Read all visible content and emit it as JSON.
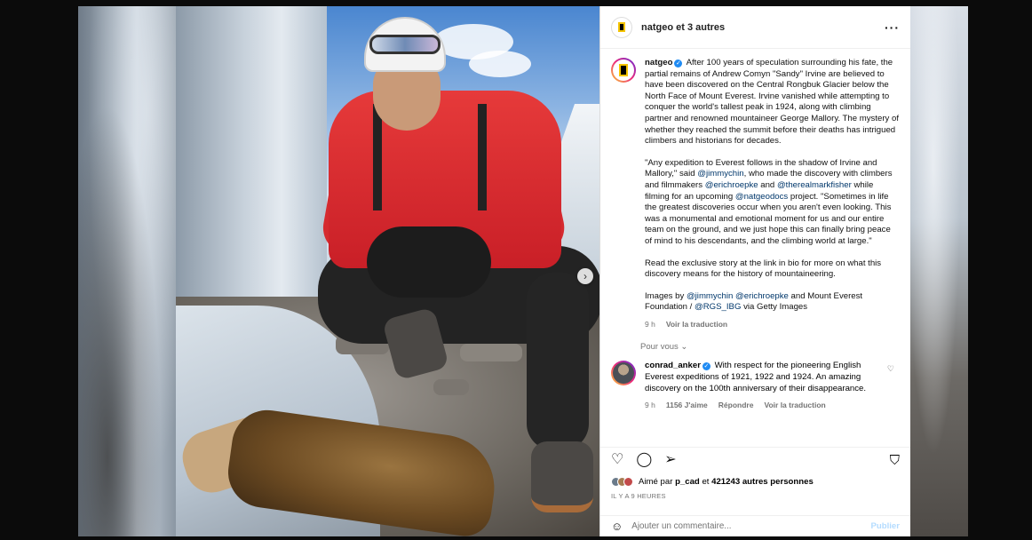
{
  "header": {
    "username": "natgeo et 3 autres",
    "more_icon": "more-horizontal-icon"
  },
  "caption": {
    "username": "natgeo",
    "paragraph1": "After 100 years of speculation surrounding his fate, the partial remains of Andrew Comyn \"Sandy\" Irvine are believed to have been discovered on the Central Rongbuk Glacier below the North Face of Mount Everest. Irvine vanished while attempting to conquer the world's tallest peak in 1924, along with climbing partner and renowned mountaineer George Mallory. The mystery of whether they reached the summit before their deaths has intrigued climbers and historians for decades.",
    "p2_a": "\"Any expedition to Everest follows in the shadow of Irvine and Mallory,\" said ",
    "p2_m1": "@jimmychin",
    "p2_b": ", who made the discovery with climbers and filmmakers ",
    "p2_m2": "@erichroepke",
    "p2_c": " and ",
    "p2_m3": "@therealmarkfisher",
    "p2_d": " while filming for an upcoming ",
    "p2_m4": "@natgeodocs",
    "p2_e": " project. \"Sometimes in life the greatest discoveries occur when you aren't even looking. This was a monumental and emotional moment for us and our entire team on the ground, and we just hope this can finally bring peace of mind to his descendants, and the climbing world at large.\"",
    "paragraph3": "Read the exclusive story at the link in bio for more on what this discovery means for the history of mountaineering.",
    "p4_a": "Images by ",
    "p4_m1": "@jimmychin",
    "p4_m2": "@erichroepke",
    "p4_b": " and Mount Everest Foundation / ",
    "p4_m3": "@RGS_IBG",
    "p4_c": " via Getty Images",
    "time": "9 h",
    "translate": "Voir la traduction"
  },
  "see_more": "Pour vous",
  "comment": {
    "username": "conrad_anker",
    "text": "With respect for the pioneering English Everest expeditions of 1921, 1922 and 1924. An amazing discovery on the 100th anniversary of their disappearance.",
    "time": "9 h",
    "likes": "1156 J'aime",
    "reply": "Répondre",
    "translate": "Voir la traduction"
  },
  "likes": {
    "prefix": "Aimé par ",
    "user": "p_cad",
    "middle": " et ",
    "count": "421243 autres personnes"
  },
  "posted_ago": "IL Y A 9 HEURES",
  "add_comment": {
    "placeholder": "Ajouter un commentaire...",
    "publish": "Publier"
  },
  "colors": {
    "mention": "#00376b",
    "verified": "#1f8bf3",
    "publish_disabled": "#b3dbff"
  }
}
